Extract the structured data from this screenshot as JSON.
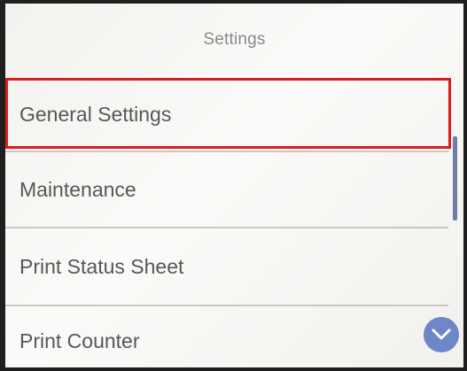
{
  "header": {
    "title": "Settings"
  },
  "menu": {
    "items": [
      {
        "label": "General Settings"
      },
      {
        "label": "Maintenance"
      },
      {
        "label": "Print Status Sheet"
      },
      {
        "label": "Print Counter"
      }
    ]
  },
  "colors": {
    "highlight_border": "#d81e1e",
    "scroll_button": "#6e87c8",
    "scrollbar": "#6f7fa3"
  },
  "icons": {
    "scroll_down": "chevron-down-icon"
  }
}
